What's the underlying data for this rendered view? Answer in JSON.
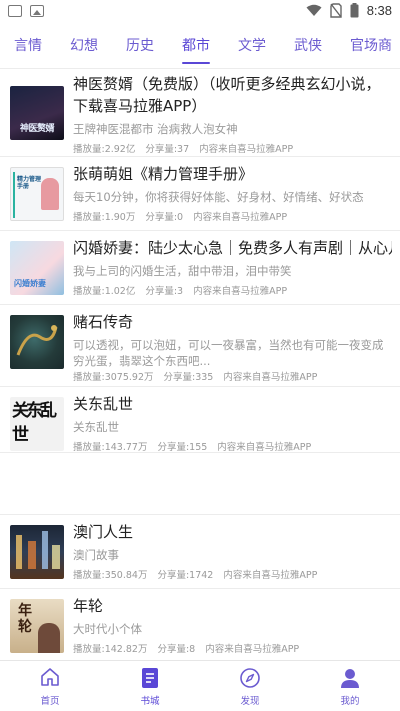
{
  "status_bar": {
    "time": "8:38"
  },
  "tabs": [
    {
      "label": "言情"
    },
    {
      "label": "幻想"
    },
    {
      "label": "历史"
    },
    {
      "label": "都市",
      "active": true
    },
    {
      "label": "文学"
    },
    {
      "label": "武侠"
    },
    {
      "label": "官场商"
    }
  ],
  "books": [
    {
      "title": "神医赘婿（免费版）（收听更多经典玄幻小说，下载喜马拉雅APP）",
      "desc": "王牌神医混都市 治病救人泡女神",
      "plays": "播放量:2.92亿",
      "shares": "分享量:37",
      "source": "内容来自喜马拉雅APP",
      "cover_text": "神医赘婿"
    },
    {
      "title": "张萌萌姐《精力管理手册》",
      "desc": "每天10分钟，你将获得好体能、好身材、好情绪、好状态",
      "plays": "播放量:1.90万",
      "shares": "分享量:0",
      "source": "内容来自喜马拉雅APP",
      "cover_text": "精力管理手册"
    },
    {
      "title": "闪婚娇妻：陆少太心急｜免费多人有声剧｜从心儿",
      "desc": "我与上司的闪婚生活，甜中带泪，泪中带笑",
      "plays": "播放量:1.02亿",
      "shares": "分享量:3",
      "source": "内容来自喜马拉雅APP",
      "cover_text": "闪婚娇妻"
    },
    {
      "title": "赌石传奇",
      "desc": "可以透视，可以泡妞，可以一夜暴富，当然也有可能一夜变成穷光蛋，翡翠这个东西吧...",
      "plays": "播放量:3075.92万",
      "shares": "分享量:335",
      "source": "内容来自喜马拉雅APP"
    },
    {
      "title": "关东乱世",
      "desc": "关东乱世",
      "plays": "播放量:143.77万",
      "shares": "分享量:155",
      "source": "内容来自喜马拉雅APP",
      "cover_text": "关东乱世"
    },
    {
      "title": "澳门人生",
      "desc": "澳门故事",
      "plays": "播放量:350.84万",
      "shares": "分享量:1742",
      "source": "内容来自喜马拉雅APP"
    },
    {
      "title": "年轮",
      "desc": "大时代小个体",
      "plays": "播放量:142.82万",
      "shares": "分享量:8",
      "source": "内容来自喜马拉雅APP",
      "cover_text": "年轮"
    }
  ],
  "bottom_nav": [
    {
      "label": "首页",
      "icon": "home-icon"
    },
    {
      "label": "书城",
      "icon": "book-icon",
      "active": true
    },
    {
      "label": "发现",
      "icon": "compass-icon"
    },
    {
      "label": "我的",
      "icon": "user-icon"
    }
  ],
  "colors": {
    "accent": "#5a47d6",
    "tab_text": "#6b5bd0",
    "meta_text": "#9a9a9a"
  }
}
